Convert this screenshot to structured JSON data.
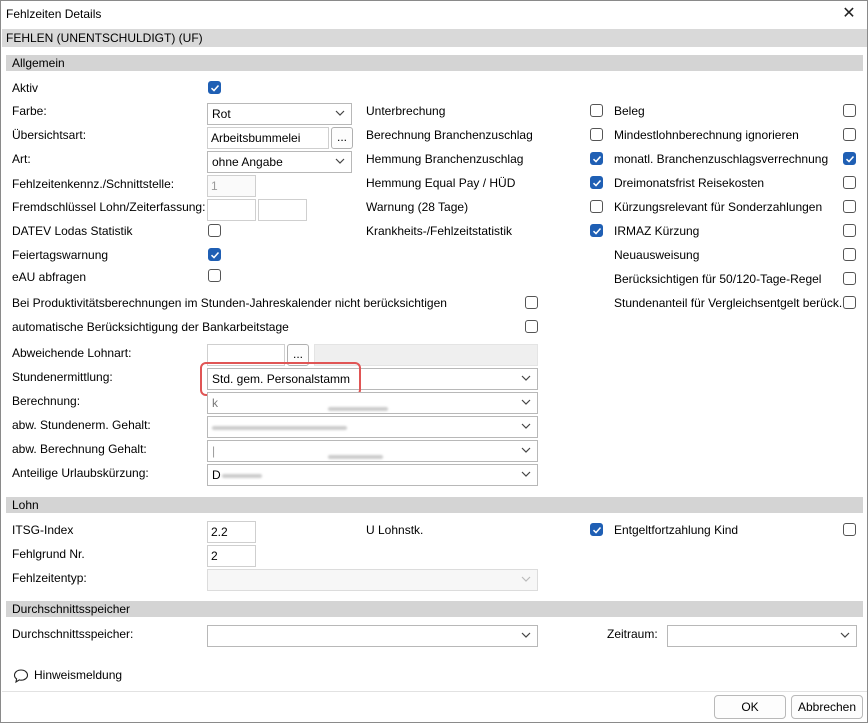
{
  "window": {
    "title": "Fehlzeiten Details",
    "close_glyph": "✕"
  },
  "header": {
    "title": "FEHLEN (UNENTSCHULDIGT) (UF)"
  },
  "sections": {
    "allgemein": "Allgemein",
    "lohn": "Lohn",
    "durchschnitt": "Durchschnittsspeicher"
  },
  "left": {
    "aktiv": "Aktiv",
    "farbe": "Farbe:",
    "farbe_value": "Rot",
    "uebersichtsart": "Übersichtsart:",
    "uebersichtsart_value": "Arbeitsbummelei",
    "art": "Art:",
    "art_value": "ohne Angabe",
    "kennz": "Fehlzeitenkennz./Schnittstelle:",
    "kennz_value": "1",
    "fremd": "Fremdschlüssel Lohn/Zeiterfassung:",
    "datev": "DATEV Lodas Statistik",
    "feiertag": "Feiertagswarnung",
    "eau": "eAU abfragen",
    "produktiv": "Bei Produktivitätsberechnungen im Stunden-Jahreskalender nicht berücksichtigen",
    "bankarbeit": "automatische Berücksichtigung der Bankarbeitstage",
    "lohnart": "Abweichende Lohnart:",
    "stundenermittlung": "Stundenermittlung:",
    "stundenermittlung_value": "Std. gem. Personalstamm",
    "berechnung": "Berechnung:",
    "berechnung_value": "k",
    "abw_stunden": "abw. Stundenerm. Gehalt:",
    "abw_berechnung": "abw. Berechnung Gehalt:",
    "abw_berechnung_value": "|",
    "urlaub": "Anteilige Urlaubskürzung:",
    "urlaub_value": "D",
    "dots": "..."
  },
  "middle": {
    "unterbrechung": "Unterbrechung",
    "branchenzuschlag": "Berechnung Branchenzuschlag",
    "hemmung_branchen": "Hemmung Branchenzuschlag",
    "hemmung_equal": "Hemmung Equal Pay / HÜD",
    "warnung": "Warnung (28 Tage)",
    "krankheit": "Krankheits-/Fehlzeitstatistik"
  },
  "right": {
    "beleg": "Beleg",
    "mindestlohn": "Mindestlohnberechnung ignorieren",
    "monatl": "monatl. Branchenzuschlagsverrechnung",
    "dreimonat": "Dreimonatsfrist Reisekosten",
    "kuerzung": "Kürzungsrelevant für Sonderzahlungen",
    "irmaz": "IRMAZ Kürzung",
    "neuaus": "Neuausweisung",
    "regel": "Berücksichtigen für 50/120-Tage-Regel",
    "stundenanteil": "Stundenanteil für Vergleichsentgelt berück."
  },
  "lohn": {
    "itsg": "ITSG-Index",
    "itsg_value": "2.2",
    "fehlgrund": "Fehlgrund Nr.",
    "fehlgrund_value": "2",
    "fehlzeitentyp": "Fehlzeitentyp:",
    "u_lohnstk": "U Lohnstk.",
    "entgelt": "Entgeltfortzahlung Kind"
  },
  "durchschnitt": {
    "speicher": "Durchschnittsspeicher:",
    "zeitraum": "Zeitraum:"
  },
  "footer": {
    "hint": "Hinweismeldung",
    "ok": "OK",
    "abbrechen": "Abbrechen"
  },
  "colors": {
    "accent": "#1f5fb4",
    "highlight": "#e05555"
  }
}
